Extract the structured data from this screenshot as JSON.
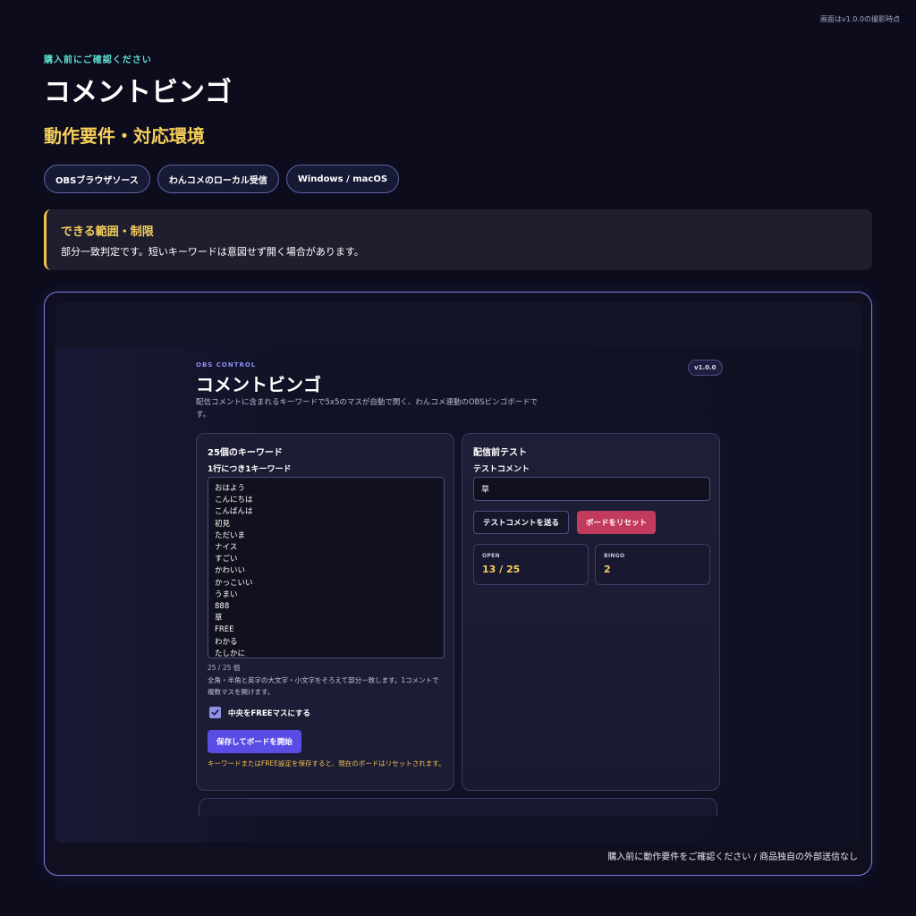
{
  "top_note": "画面はv1.0.0の撮影時点",
  "header": {
    "kicker": "購入前にご確認ください",
    "title": "コメントビンゴ",
    "subtitle": "動作要件・対応環境"
  },
  "chips": [
    "OBSブラウザソース",
    "わんコメのローカル受信",
    "Windows / macOS"
  ],
  "notice": {
    "title": "できる範囲・制限",
    "body": "部分一致判定です。短いキーワードは意図せず開く場合があります。"
  },
  "frame_footer": "購入前に動作要件をご確認ください / 商品独自の外部送信なし",
  "app": {
    "kicker": "OBS CONTROL",
    "title": "コメントビンゴ",
    "description": "配信コメントに含まれるキーワードで5x5のマスが自動で開く、わんコメ連動のOBSビンゴボードです。",
    "version": "v1.0.0",
    "keywords_card": {
      "heading": "25個のキーワード",
      "field_label": "1行につき1キーワード",
      "keywords": [
        "おはよう",
        "こんにちは",
        "こんばんは",
        "初見",
        "ただいま",
        "ナイス",
        "すごい",
        "かわいい",
        "かっこいい",
        "うまい",
        "888",
        "草",
        "FREE",
        "わかる",
        "たしかに"
      ],
      "count": "25 / 25 個",
      "hint": "全角・半角と英字の大文字・小文字をそろえて部分一致します。1コメントで複数マスを開けます。",
      "free_checkbox_label": "中央をFREEマスにする",
      "free_checked": true,
      "save_button": "保存してボードを開始",
      "warning": "キーワードまたはFREE設定を保存すると、現在のボードはリセットされます。"
    },
    "test_card": {
      "heading": "配信前テスト",
      "field_label": "テストコメント",
      "input_value": "草",
      "send_button": "テストコメントを送る",
      "reset_button": "ボードをリセット",
      "stats": [
        {
          "label": "OPEN",
          "value": "13 / 25"
        },
        {
          "label": "BINGO",
          "value": "2"
        }
      ]
    }
  },
  "colors": {
    "background": "#0c0c1c",
    "accent_yellow": "#f6cf5b",
    "accent_teal": "#5fe1cf",
    "primary_button": "#5a4de6",
    "danger_button": "#c23a5c",
    "frame_border": "#7c7fe6"
  }
}
